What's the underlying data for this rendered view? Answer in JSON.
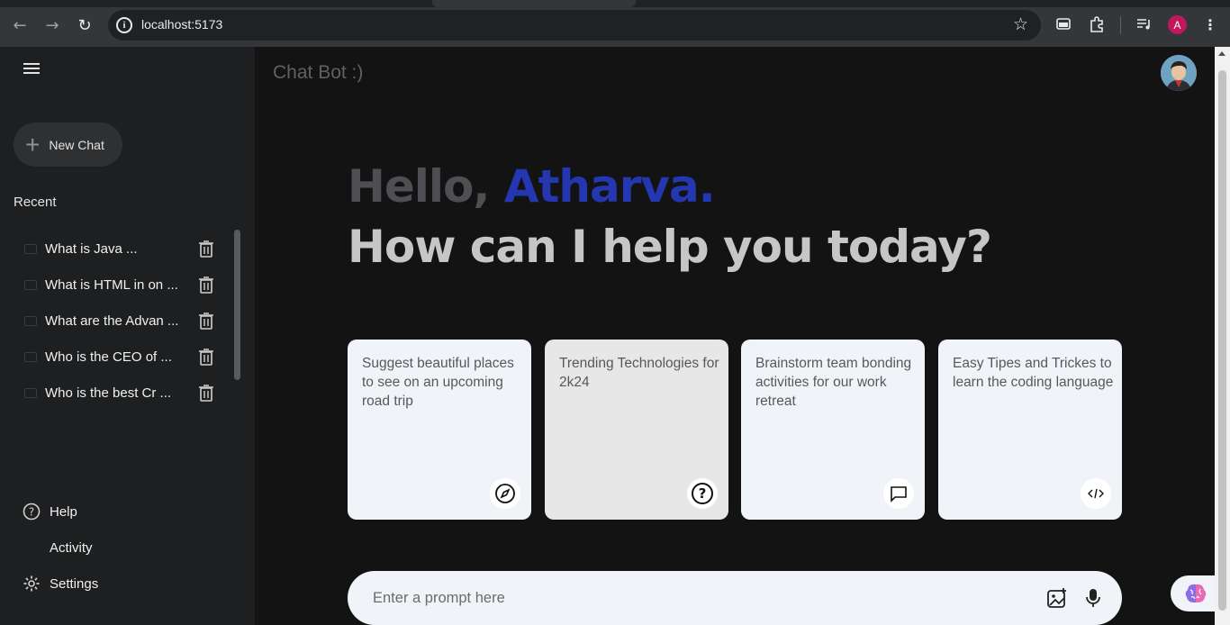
{
  "browser": {
    "url": "localhost:5173",
    "profile_initial": "A"
  },
  "sidebar": {
    "new_chat_label": "New Chat",
    "recent_title": "Recent",
    "recent_items": [
      {
        "label": "What is Java ..."
      },
      {
        "label": "What is HTML in on ..."
      },
      {
        "label": "What are the Advan ..."
      },
      {
        "label": "Who is the CEO of ..."
      },
      {
        "label": "Who is the best Cr ..."
      }
    ],
    "bottom": {
      "help": "Help",
      "activity": "Activity",
      "settings": "Settings"
    }
  },
  "main": {
    "brand": "Chat Bot :)",
    "greeting_hello": "Hello, ",
    "greeting_name": "Atharva.",
    "greeting_sub": "How can I help you today?",
    "cards": [
      {
        "text": "Suggest beautiful places to see on an upcoming road trip",
        "icon": "compass-icon"
      },
      {
        "text": "Trending Technologies for 2k24",
        "icon": "question-icon"
      },
      {
        "text": "Brainstorm team bonding activities for our work retreat",
        "icon": "message-icon"
      },
      {
        "text": "Easy Tipes and Trickes to learn the coding language",
        "icon": "code-icon"
      }
    ],
    "prompt_placeholder": "Enter a prompt here"
  },
  "colors": {
    "sidebar_bg": "#1e1f20",
    "main_bg": "#131314",
    "name_accent": "#2536b1",
    "card_bg": "#f0f4f9"
  }
}
